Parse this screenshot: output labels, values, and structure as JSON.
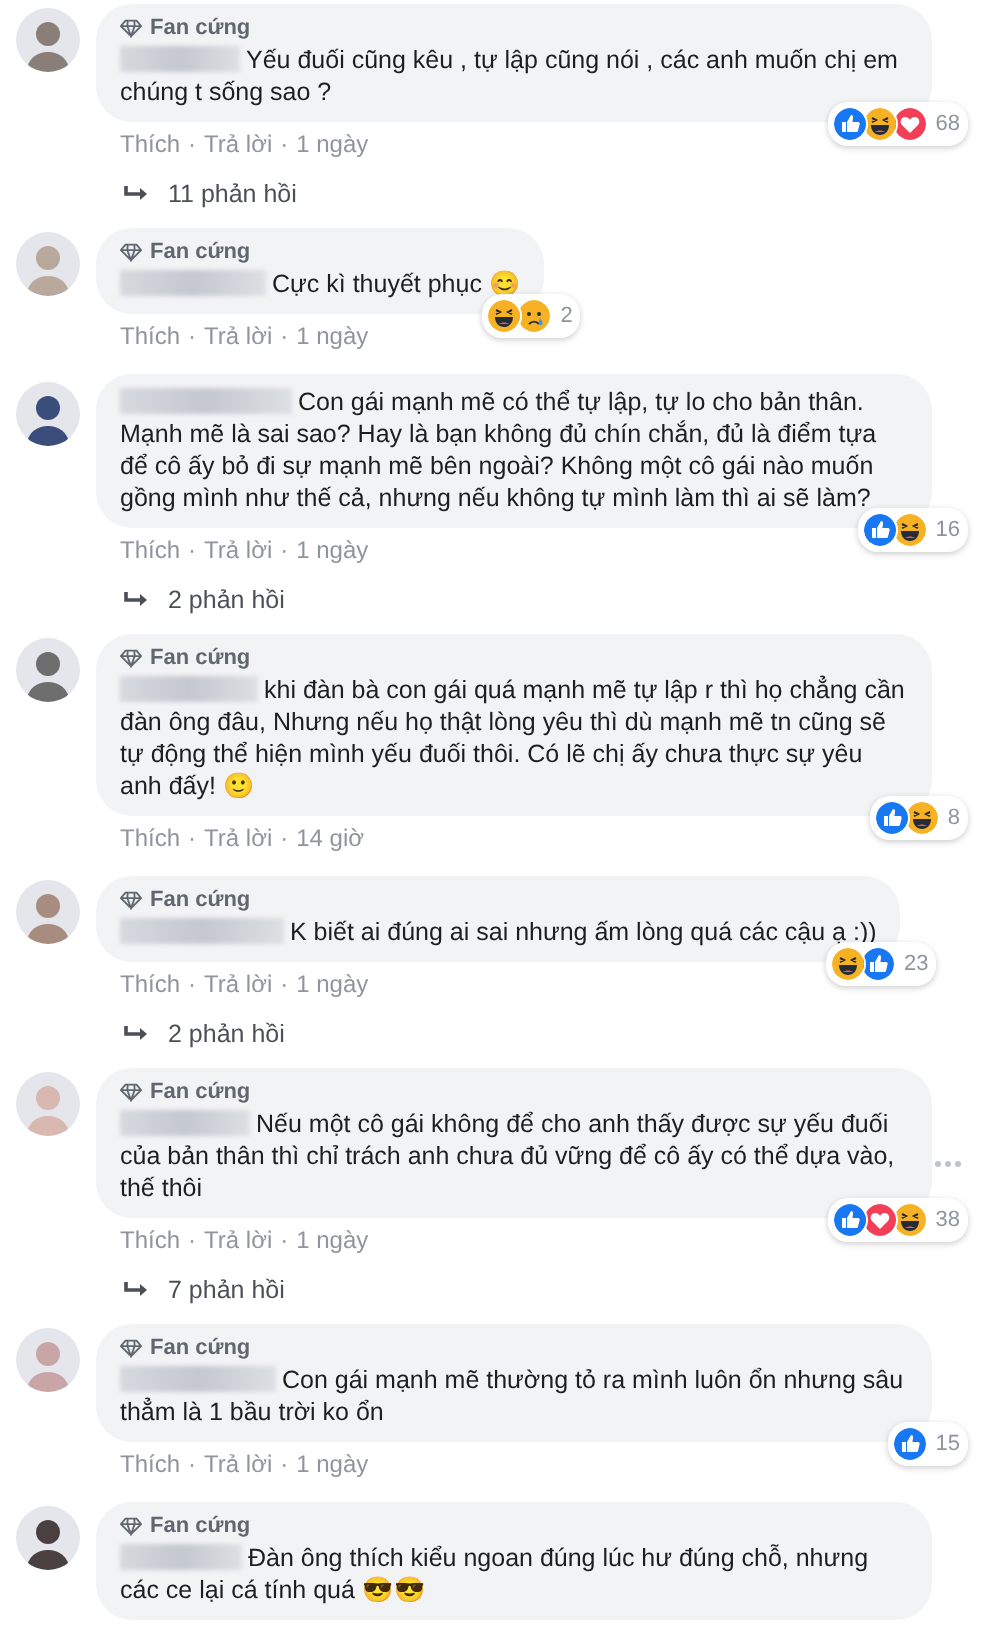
{
  "separator": "·",
  "comments": [
    {
      "badge": "Fan cứng",
      "text": "Yếu đuối cũng kêu , tự lập cũng nói , các anh muốn chị em chúng t sống sao ?",
      "reactions": [
        {
          "kind": "like"
        },
        {
          "kind": "haha"
        },
        {
          "kind": "love"
        }
      ],
      "count": "68",
      "like": "Thích",
      "reply": "Trả lời",
      "time": "1 ngày",
      "replies": "11 phản hồi"
    },
    {
      "badge": "Fan cứng",
      "text": "Cực kì thuyết phục 😊",
      "reactions": [
        {
          "kind": "haha"
        },
        {
          "kind": "sad"
        }
      ],
      "count": "2",
      "like": "Thích",
      "reply": "Trả lời",
      "time": "1 ngày"
    },
    {
      "text": "Con gái mạnh mẽ có thể tự lập, tự lo cho bản thân. Mạnh mẽ là sai sao? Hay là bạn không đủ chín chắn, đủ là điểm tựa để cô ấy bỏ đi sự mạnh mẽ bên ngoài? Không một cô gái nào muốn gồng mình như thế cả, nhưng nếu không tự mình làm thì ai sẽ làm?",
      "reactions": [
        {
          "kind": "like"
        },
        {
          "kind": "haha"
        }
      ],
      "count": "16",
      "like": "Thích",
      "reply": "Trả lời",
      "time": "1 ngày",
      "replies": "2 phản hồi"
    },
    {
      "badge": "Fan cứng",
      "text": "khi đàn bà con gái quá mạnh mẽ tự lập r thì họ chẳng cần đàn ông đâu, Nhưng nếu họ thật lòng yêu thì dù mạnh mẽ tn cũng sẽ tự động thể hiện mình yếu đuối thôi. Có lẽ chị ấy chưa thực sự yêu anh đấy! 🙂",
      "reactions": [
        {
          "kind": "like"
        },
        {
          "kind": "haha"
        }
      ],
      "count": "8",
      "like": "Thích",
      "reply": "Trả lời",
      "time": "14 giờ"
    },
    {
      "badge": "Fan cứng",
      "text": "K biết ai đúng ai sai nhưng ấm lòng quá các cậu ạ :))",
      "reactions": [
        {
          "kind": "haha"
        },
        {
          "kind": "like"
        }
      ],
      "count": "23",
      "like": "Thích",
      "reply": "Trả lời",
      "time": "1 ngày",
      "replies": "2 phản hồi"
    },
    {
      "badge": "Fan cứng",
      "text": "Nếu một cô gái không để cho anh thấy được sự yếu đuối của bản thân thì chỉ trách anh chưa đủ vững để cô ấy có thể dựa vào, thế thôi",
      "reactions": [
        {
          "kind": "like"
        },
        {
          "kind": "love"
        },
        {
          "kind": "haha"
        }
      ],
      "count": "38",
      "like": "Thích",
      "reply": "Trả lời",
      "time": "1 ngày",
      "replies": "7 phản hồi",
      "menu": true
    },
    {
      "badge": "Fan cứng",
      "text": "Con gái mạnh mẽ thường tỏ ra mình luôn ổn nhưng sâu thẳm là 1 bầu trời ko ổn",
      "reactions": [
        {
          "kind": "like"
        }
      ],
      "count": "15",
      "like": "Thích",
      "reply": "Trả lời",
      "time": "1 ngày"
    },
    {
      "badge": "Fan cứng",
      "text": "Đàn ông thích kiểu ngoan đúng lúc hư đúng chỗ, nhưng các ce lại cá tính quá 😎😎"
    }
  ]
}
